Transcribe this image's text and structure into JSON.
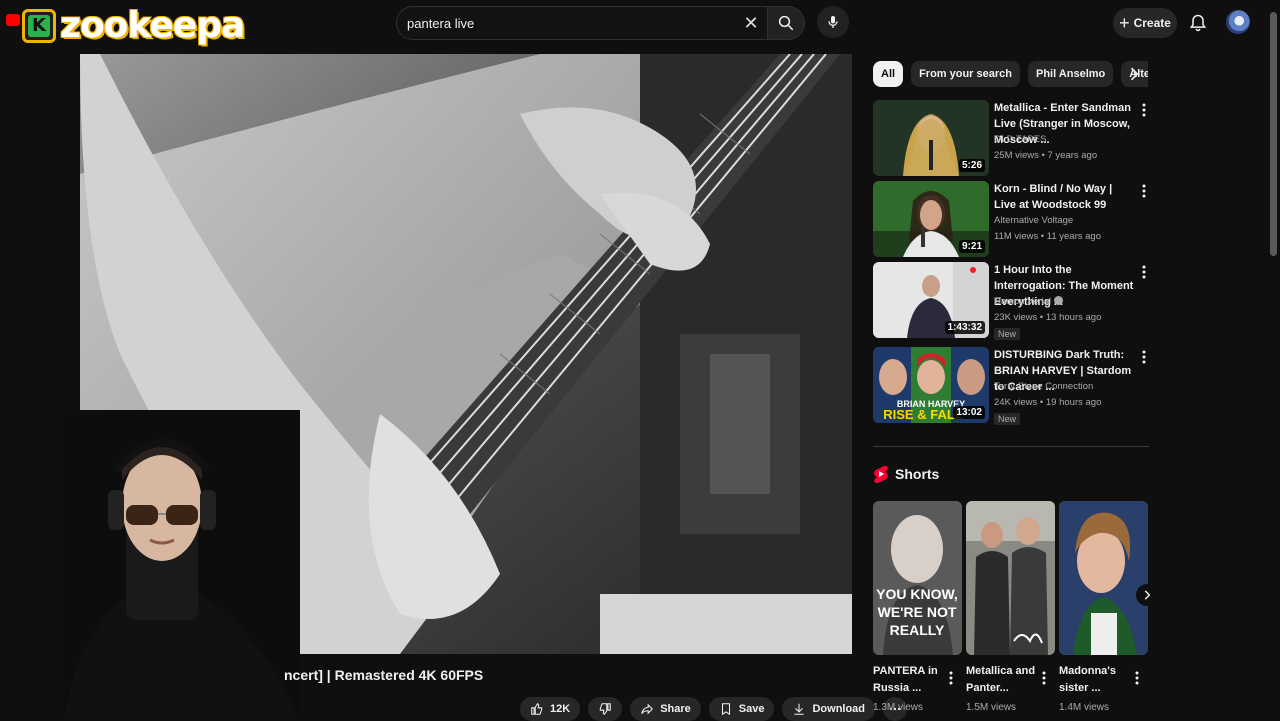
{
  "brand": {
    "name": "zookeepa",
    "mark": "K"
  },
  "search": {
    "query": "pantera live"
  },
  "topbar": {
    "create_label": "Create"
  },
  "video": {
    "title_visible": "ncert] | Remastered 4K 60FPS"
  },
  "actions": {
    "like_count": "12K",
    "share_label": "Share",
    "save_label": "Save",
    "download_label": "Download"
  },
  "chips": [
    "All",
    "From your search",
    "Phil Anselmo",
    "Alter"
  ],
  "recommendations": [
    {
      "title": "Metallica - Enter Sandman Live (Stranger in Moscow, Moscow ...",
      "channel": "OLD TAPES",
      "meta": "25M views • 7 years ago",
      "duration": "5:26",
      "verified": false,
      "badge": ""
    },
    {
      "title": "Korn - Blind / No Way | Live at Woodstock 99",
      "channel": "Alternative Voltage",
      "meta": "11M views • 11 years ago",
      "duration": "9:21",
      "verified": false,
      "badge": ""
    },
    {
      "title": "1 Hour Into the Interrogation: The Moment Everything ...",
      "channel": "Damon Verial",
      "meta": "23K views • 13 hours ago",
      "duration": "1:43:32",
      "verified": true,
      "badge": "New"
    },
    {
      "title": "DISTURBING Dark Truth: BRIAN HARVEY | Stardom to Career ...",
      "channel": "Terry Stone Connection",
      "meta": "24K views • 19 hours ago",
      "duration": "13:02",
      "verified": false,
      "badge": "New",
      "thumb_text_1": "BRIAN HARVEY",
      "thumb_text_2": "RISE & FALL"
    }
  ],
  "shorts": {
    "heading": "Shorts",
    "items": [
      {
        "title": "PANTERA in Russia ...",
        "views": "1.3M views",
        "overlay_1": "YOU KNOW,",
        "overlay_2": "WE'RE NOT",
        "overlay_3": "REALLY"
      },
      {
        "title": "Metallica and Panter...",
        "views": "1.5M views"
      },
      {
        "title": "Madonna's sister ...",
        "views": "1.4M views"
      }
    ]
  },
  "colors": {
    "background": "#0f0f0f",
    "chip_active": "#f1f1f1",
    "shorts_red": "#ff0033",
    "brand_gold": "#f0b400",
    "brand_green": "#2bb24c"
  }
}
